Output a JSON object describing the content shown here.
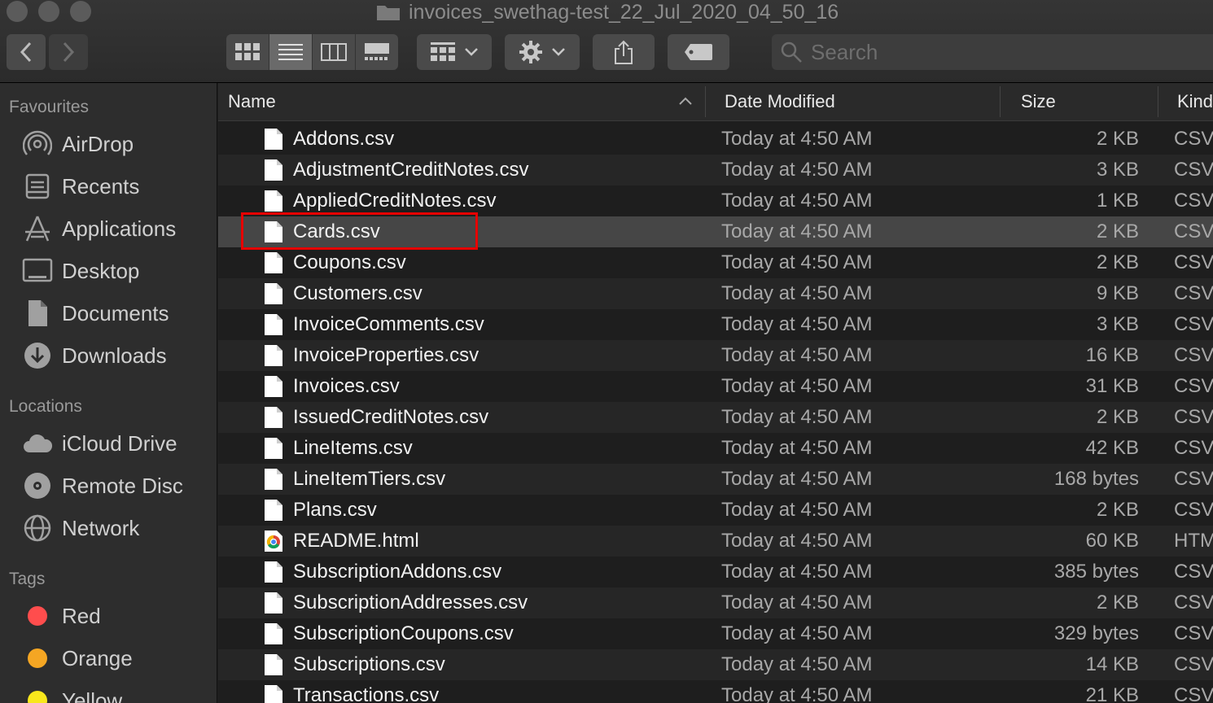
{
  "window": {
    "title": "invoices_swethag-test_22_Jul_2020_04_50_16"
  },
  "toolbar": {
    "search_placeholder": "Search",
    "icons": [
      "back-icon",
      "forward-icon",
      "icon-view-icon",
      "list-view-icon",
      "column-view-icon",
      "gallery-view-icon",
      "group-icon",
      "gear-icon",
      "share-icon",
      "tag-icon",
      "search-icon"
    ]
  },
  "sidebar": {
    "favourites_heading": "Favourites",
    "favourites": [
      {
        "label": "AirDrop",
        "icon": "airdrop-icon"
      },
      {
        "label": "Recents",
        "icon": "recents-icon"
      },
      {
        "label": "Applications",
        "icon": "applications-icon"
      },
      {
        "label": "Desktop",
        "icon": "desktop-icon"
      },
      {
        "label": "Documents",
        "icon": "documents-icon"
      },
      {
        "label": "Downloads",
        "icon": "downloads-icon"
      }
    ],
    "locations_heading": "Locations",
    "locations": [
      {
        "label": "iCloud Drive",
        "icon": "icloud-icon"
      },
      {
        "label": "Remote Disc",
        "icon": "disc-icon"
      },
      {
        "label": "Network",
        "icon": "network-icon"
      }
    ],
    "tags_heading": "Tags",
    "tags": [
      {
        "label": "Red",
        "color": "#ff4d4d"
      },
      {
        "label": "Orange",
        "color": "#f5a623"
      },
      {
        "label": "Yellow",
        "color": "#f8e71c"
      }
    ]
  },
  "columns": {
    "name": "Name",
    "date": "Date Modified",
    "size": "Size",
    "kind": "Kind"
  },
  "files": [
    {
      "name": "Addons.csv",
      "date": "Today at 4:50 AM",
      "size": "2 KB",
      "kind": "CSV",
      "icon": "document-icon"
    },
    {
      "name": "AdjustmentCreditNotes.csv",
      "date": "Today at 4:50 AM",
      "size": "3 KB",
      "kind": "CSV",
      "icon": "document-icon"
    },
    {
      "name": "AppliedCreditNotes.csv",
      "date": "Today at 4:50 AM",
      "size": "1 KB",
      "kind": "CSV",
      "icon": "document-icon"
    },
    {
      "name": "Cards.csv",
      "date": "Today at 4:50 AM",
      "size": "2 KB",
      "kind": "CSV",
      "icon": "document-icon",
      "selected": true
    },
    {
      "name": "Coupons.csv",
      "date": "Today at 4:50 AM",
      "size": "2 KB",
      "kind": "CSV",
      "icon": "document-icon"
    },
    {
      "name": "Customers.csv",
      "date": "Today at 4:50 AM",
      "size": "9 KB",
      "kind": "CSV",
      "icon": "document-icon"
    },
    {
      "name": "InvoiceComments.csv",
      "date": "Today at 4:50 AM",
      "size": "3 KB",
      "kind": "CSV",
      "icon": "document-icon"
    },
    {
      "name": "InvoiceProperties.csv",
      "date": "Today at 4:50 AM",
      "size": "16 KB",
      "kind": "CSV",
      "icon": "document-icon"
    },
    {
      "name": "Invoices.csv",
      "date": "Today at 4:50 AM",
      "size": "31 KB",
      "kind": "CSV",
      "icon": "document-icon"
    },
    {
      "name": "IssuedCreditNotes.csv",
      "date": "Today at 4:50 AM",
      "size": "2 KB",
      "kind": "CSV",
      "icon": "document-icon"
    },
    {
      "name": "LineItems.csv",
      "date": "Today at 4:50 AM",
      "size": "42 KB",
      "kind": "CSV",
      "icon": "document-icon"
    },
    {
      "name": "LineItemTiers.csv",
      "date": "Today at 4:50 AM",
      "size": "168 bytes",
      "kind": "CSV",
      "icon": "document-icon"
    },
    {
      "name": "Plans.csv",
      "date": "Today at 4:50 AM",
      "size": "2 KB",
      "kind": "CSV",
      "icon": "document-icon"
    },
    {
      "name": "README.html",
      "date": "Today at 4:50 AM",
      "size": "60 KB",
      "kind": "HTM",
      "icon": "chrome-icon"
    },
    {
      "name": "SubscriptionAddons.csv",
      "date": "Today at 4:50 AM",
      "size": "385 bytes",
      "kind": "CSV",
      "icon": "document-icon"
    },
    {
      "name": "SubscriptionAddresses.csv",
      "date": "Today at 4:50 AM",
      "size": "2 KB",
      "kind": "CSV",
      "icon": "document-icon"
    },
    {
      "name": "SubscriptionCoupons.csv",
      "date": "Today at 4:50 AM",
      "size": "329 bytes",
      "kind": "CSV",
      "icon": "document-icon"
    },
    {
      "name": "Subscriptions.csv",
      "date": "Today at 4:50 AM",
      "size": "14 KB",
      "kind": "CSV",
      "icon": "document-icon"
    },
    {
      "name": "Transactions.csv",
      "date": "Today at 4:50 AM",
      "size": "21 KB",
      "kind": "CSV",
      "icon": "document-icon"
    }
  ],
  "annotation": {
    "highlighted_file": "Cards.csv",
    "color": "#e60000"
  }
}
